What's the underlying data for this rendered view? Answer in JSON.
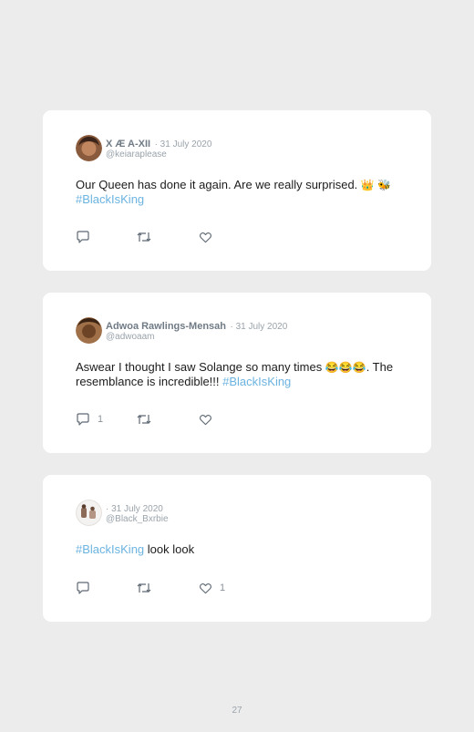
{
  "tweets": [
    {
      "author": "X Æ A-XII",
      "date": "· 31 July 2020",
      "handle": "@keiaraplease",
      "text": "Our Queen has done it again. Are we really surprised. ",
      "emoji": "👑 🐝",
      "hashtag": "#BlackIsKing",
      "reply_count": "",
      "like_count": ""
    },
    {
      "author": "Adwoa Rawlings-Mensah",
      "date": "· 31 July 2020",
      "handle": "@adwoaam",
      "text_before": "Aswear I thought I saw Solange so many times ",
      "emoji": "😂😂😂",
      "text_after": ". The resemblance is incredible!!! ",
      "hashtag": "#BlackIsKing",
      "reply_count": "1",
      "like_count": ""
    },
    {
      "author": "",
      "date": "· 31 July 2020",
      "handle": "@Black_Bxrbie",
      "hashtag": "#BlackIsKing",
      "text": " look look",
      "reply_count": "",
      "like_count": "1"
    }
  ],
  "page_number": "27",
  "colors": {
    "background": "#ececec",
    "card": "#ffffff",
    "hashtag": "#6bb3e0",
    "author": "#707b86",
    "muted": "#9aa3ab",
    "icon": "#5f6973"
  },
  "icons": [
    "reply-icon",
    "retweet-icon",
    "like-icon"
  ]
}
